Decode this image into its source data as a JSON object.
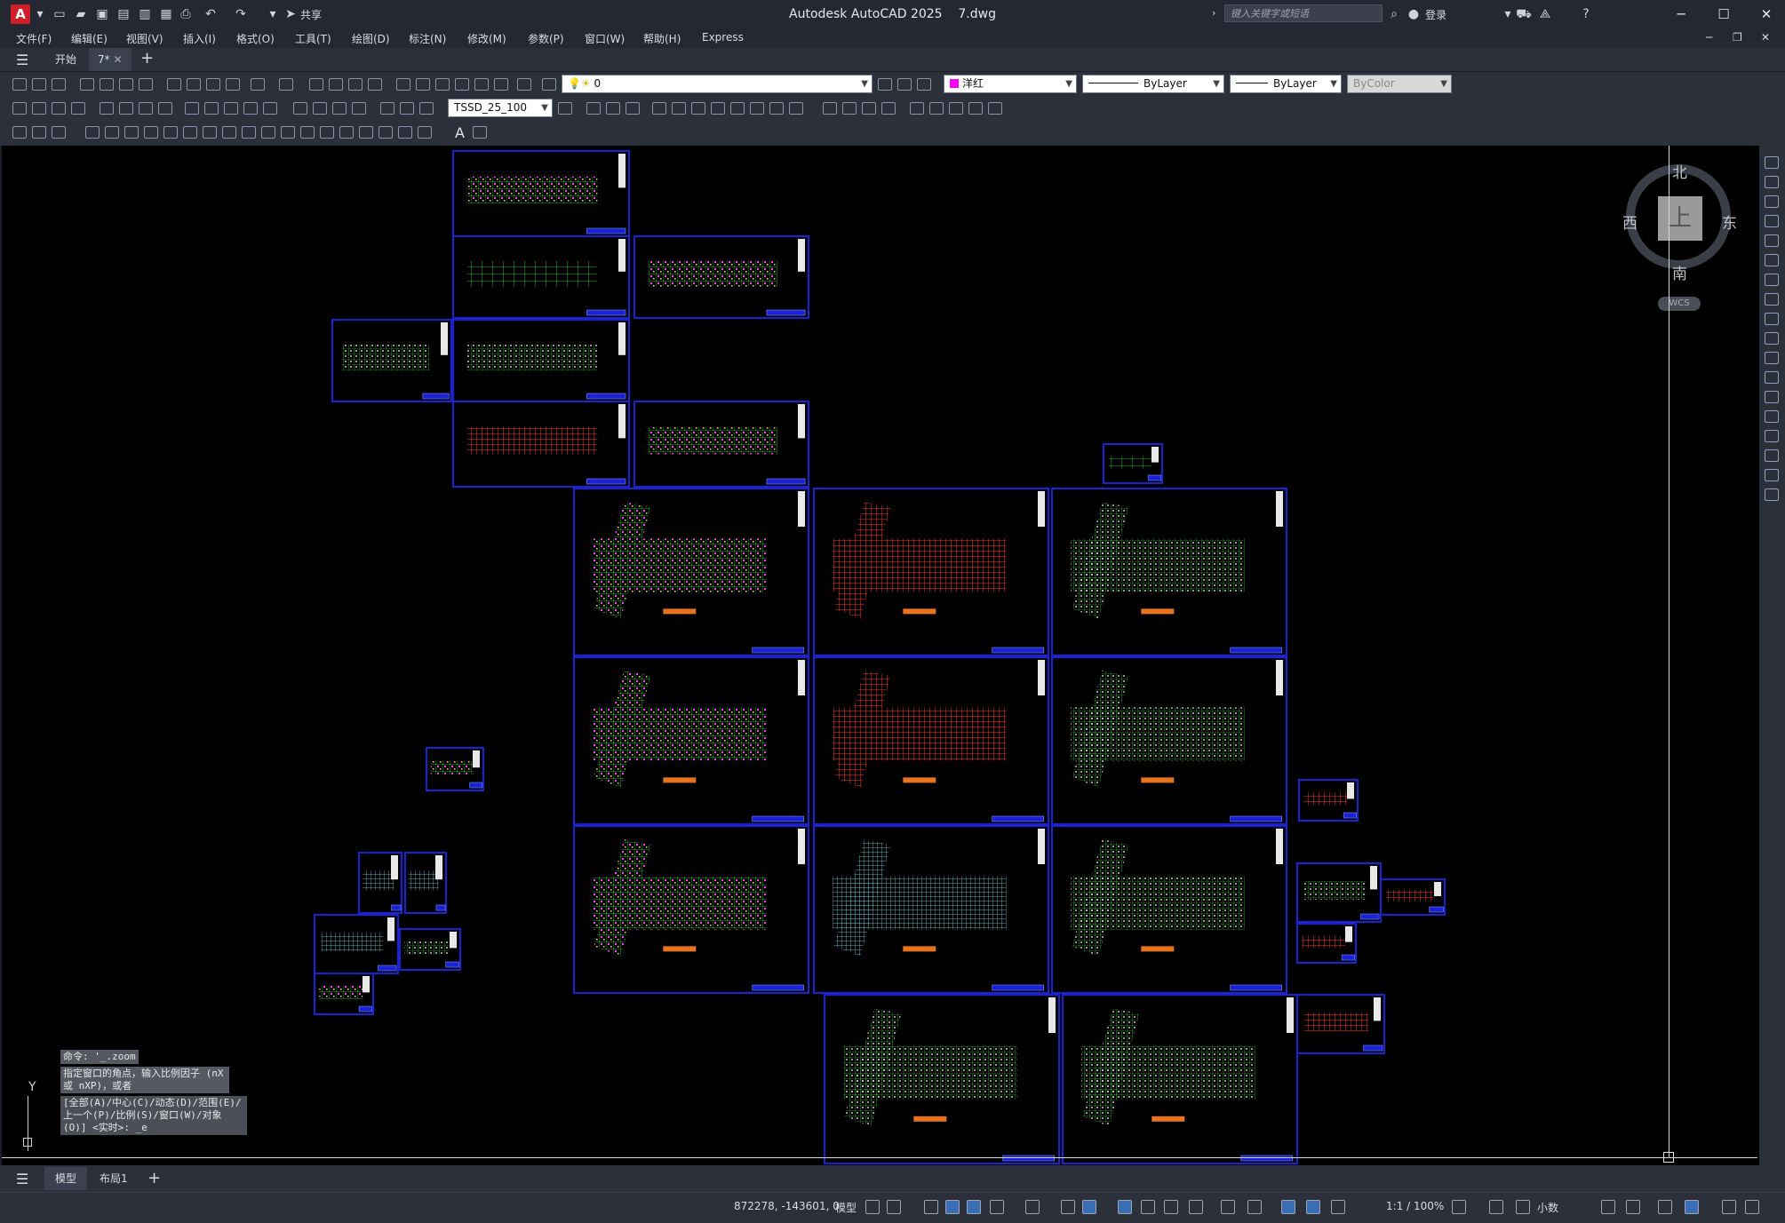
{
  "title": {
    "app_name": "Autodesk AutoCAD 2025",
    "file_name": "7.dwg",
    "search_placeholder": "键入关键字或短语",
    "login_label": "登录",
    "share_label": "共享",
    "logo_letter": "A"
  },
  "menu": {
    "items": [
      "文件(F)",
      "编辑(E)",
      "视图(V)",
      "插入(I)",
      "格式(O)",
      "工具(T)",
      "绘图(D)",
      "标注(N)",
      "修改(M)",
      "参数(P)",
      "窗口(W)",
      "帮助(H)",
      "Express"
    ]
  },
  "doc_tabs": {
    "start": "开始",
    "active": "7*"
  },
  "properties": {
    "layer": "0",
    "color_name": "洋红",
    "color_hex": "#ff00ff",
    "linetype": "ByLayer",
    "lineweight": "ByLayer",
    "plot_style": "ByColor",
    "dim_style": "TSSD_25_100"
  },
  "viewcube": {
    "north": "北",
    "south": "南",
    "east": "东",
    "west": "西",
    "face": "上",
    "ucs": "WCS"
  },
  "command": {
    "history": [
      "命令: '_.zoom",
      "指定窗口的角点，输入比例因子 (nX 或 nXP)，或者"
    ],
    "prompt": "[全部(A)/中心(C)/动态(D)/范围(E)/上一个(P)/比例(S)/窗口(W)/对象(O)] <实时>: _e"
  },
  "ucs_axis": {
    "y": "Y"
  },
  "layout_tabs": {
    "model": "模型",
    "layout1": "布局1"
  },
  "status": {
    "coords": "872278, -143601, 0",
    "model": "模型",
    "scale": "1:1 / 100%",
    "units": "小数"
  },
  "colors": {
    "sheet_border": "#1a22d8",
    "plan_green": "#19e619",
    "canvas": "#000000"
  }
}
